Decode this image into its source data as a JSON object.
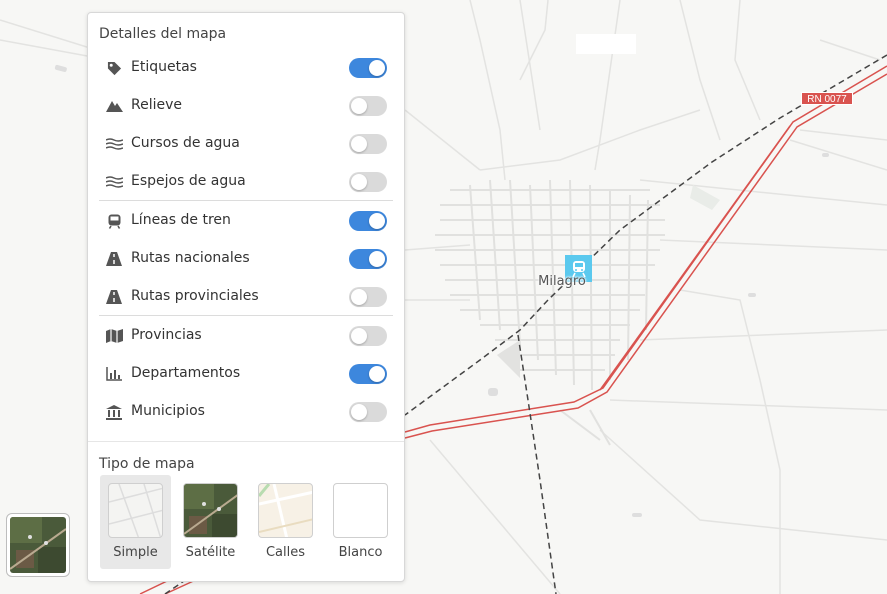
{
  "map": {
    "town_label": "Milagro",
    "route_shield": "RN 0077",
    "colors": {
      "background": "#f7f7f5",
      "streets": "#e1e1df",
      "national_route": "#d9534f",
      "railway": "#444444",
      "station": "#5bc9ee"
    }
  },
  "panel": {
    "title": "Detalles del mapa",
    "layers": [
      {
        "label": "Etiquetas",
        "icon": "tag-icon",
        "on": true
      },
      {
        "label": "Relieve",
        "icon": "mountain-icon",
        "on": false
      },
      {
        "label": "Cursos de agua",
        "icon": "water-waves-icon",
        "on": false
      },
      {
        "label": "Espejos de agua",
        "icon": "water-waves-icon",
        "on": false
      },
      {
        "label": "Líneas de tren",
        "icon": "train-icon",
        "on": true
      },
      {
        "label": "Rutas nacionales",
        "icon": "road-icon",
        "on": true
      },
      {
        "label": "Rutas provinciales",
        "icon": "road-icon",
        "on": false
      },
      {
        "label": "Provincias",
        "icon": "folded-map-icon",
        "on": false
      },
      {
        "label": "Departamentos",
        "icon": "bar-chart-icon",
        "on": true
      },
      {
        "label": "Municipios",
        "icon": "institution-icon",
        "on": false
      }
    ],
    "map_type_title": "Tipo de mapa",
    "map_types": [
      {
        "label": "Simple",
        "selected": true
      },
      {
        "label": "Satélite",
        "selected": false
      },
      {
        "label": "Calles",
        "selected": false
      },
      {
        "label": "Blanco",
        "selected": false
      }
    ]
  }
}
